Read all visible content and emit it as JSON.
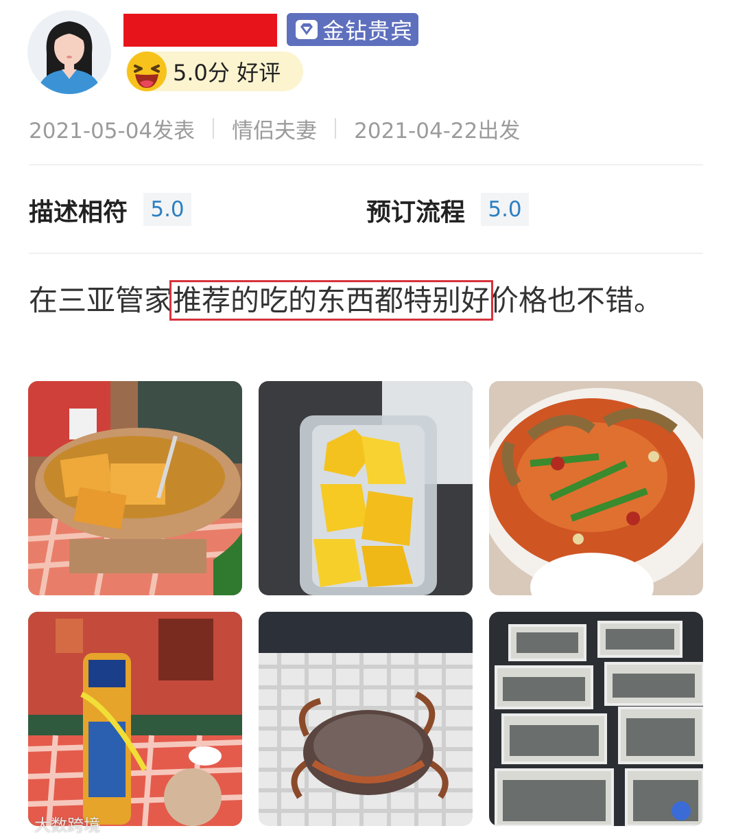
{
  "user": {
    "vip_badge": "金钻贵宾",
    "score_text": "5.0分 好评"
  },
  "meta": {
    "posted": "2021-05-04发表",
    "trip_type": "情侣夫妻",
    "departed": "2021-04-22出发"
  },
  "ratings": [
    {
      "label": "描述相符",
      "value": "5.0"
    },
    {
      "label": "预订流程",
      "value": "5.0"
    }
  ],
  "review": {
    "prefix": "在三亚管家",
    "highlight": "推荐的吃的东西都特别好",
    "suffix": "价格也不错。"
  },
  "photos": [
    {
      "subject": "tofu-soup-pot"
    },
    {
      "subject": "mango-box"
    },
    {
      "subject": "spicy-crab-plate"
    },
    {
      "subject": "beer-coconut-table"
    },
    {
      "subject": "crab-in-basket"
    },
    {
      "subject": "seafood-tanks"
    }
  ],
  "watermark": "大数跨境",
  "colors": {
    "redaction": "#e8141c",
    "vip_badge_bg": "#5e6fbd",
    "score_pill_bg": "#fbf4cf",
    "rating_value_color": "#2d7fc1",
    "highlight_border": "#d6323b"
  }
}
